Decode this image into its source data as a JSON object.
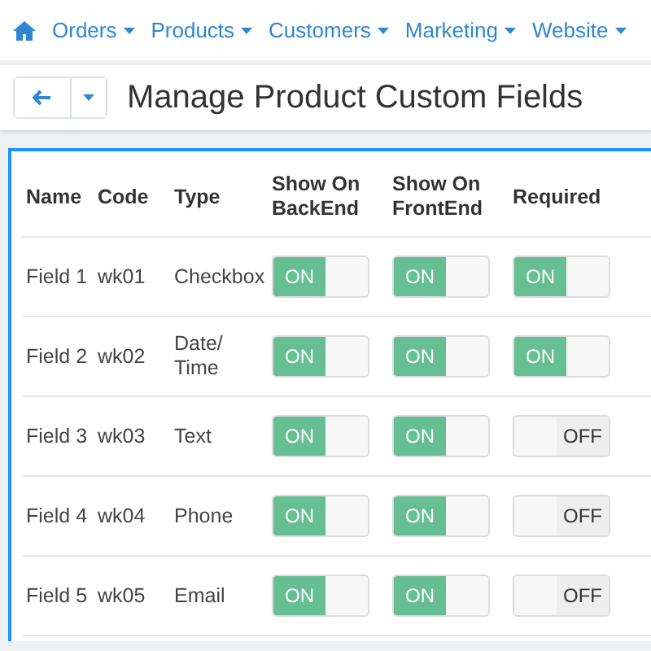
{
  "nav": {
    "items": [
      {
        "label": "Orders"
      },
      {
        "label": "Products"
      },
      {
        "label": "Customers"
      },
      {
        "label": "Marketing"
      },
      {
        "label": "Website"
      }
    ]
  },
  "header": {
    "title": "Manage Product Custom Fields"
  },
  "table": {
    "columns": [
      "Name",
      "Code",
      "Type",
      "Show On BackEnd",
      "Show On FrontEnd",
      "Required"
    ],
    "rows": [
      {
        "name": "Field 1",
        "code": "wk01",
        "type": "Checkbox",
        "toggles": [
          {
            "on": true,
            "label": "ON"
          },
          {
            "on": true,
            "label": "ON"
          },
          {
            "on": true,
            "label": "ON"
          }
        ]
      },
      {
        "name": "Field 2",
        "code": "wk02",
        "type": "Date/ Time",
        "toggles": [
          {
            "on": true,
            "label": "ON"
          },
          {
            "on": true,
            "label": "ON"
          },
          {
            "on": true,
            "label": "ON"
          }
        ]
      },
      {
        "name": "Field 3",
        "code": "wk03",
        "type": "Text",
        "toggles": [
          {
            "on": true,
            "label": "ON"
          },
          {
            "on": true,
            "label": "ON"
          },
          {
            "on": false,
            "label": "OFF"
          }
        ]
      },
      {
        "name": "Field 4",
        "code": "wk04",
        "type": "Phone",
        "toggles": [
          {
            "on": true,
            "label": "ON"
          },
          {
            "on": true,
            "label": "ON"
          },
          {
            "on": false,
            "label": "OFF"
          }
        ]
      },
      {
        "name": "Field 5",
        "code": "wk05",
        "type": "Email",
        "toggles": [
          {
            "on": true,
            "label": "ON"
          },
          {
            "on": true,
            "label": "ON"
          },
          {
            "on": false,
            "label": "OFF"
          }
        ]
      }
    ]
  }
}
